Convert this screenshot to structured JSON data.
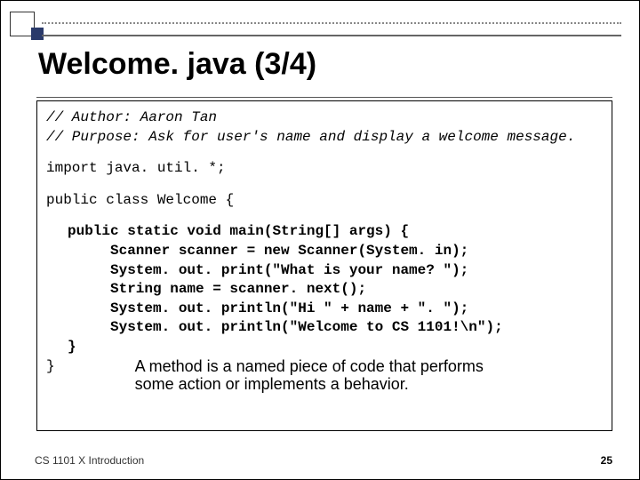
{
  "title": "Welcome. java (3/4)",
  "code": {
    "comment1": "// Author: Aaron Tan",
    "comment2": "// Purpose: Ask for user's name and display a welcome message.",
    "import_line": "import java. util. *;",
    "class_decl": "public class Welcome {",
    "main_sig": "public static void main(String[] args) {",
    "line1": "Scanner scanner = new Scanner(System. in);",
    "line2": "System. out. print(\"What is your name? \");",
    "line3": "String name = scanner. next();",
    "line4": "System. out. println(\"Hi \" + name + \". \");",
    "line5": "System. out. println(\"Welcome to CS 1101!\\n\");",
    "close_method": "}",
    "close_class": "}"
  },
  "annotation": "A method is a named piece of code that performs some action or implements a behavior.",
  "footer": {
    "left": "CS 1101 X Introduction",
    "right": "25"
  }
}
